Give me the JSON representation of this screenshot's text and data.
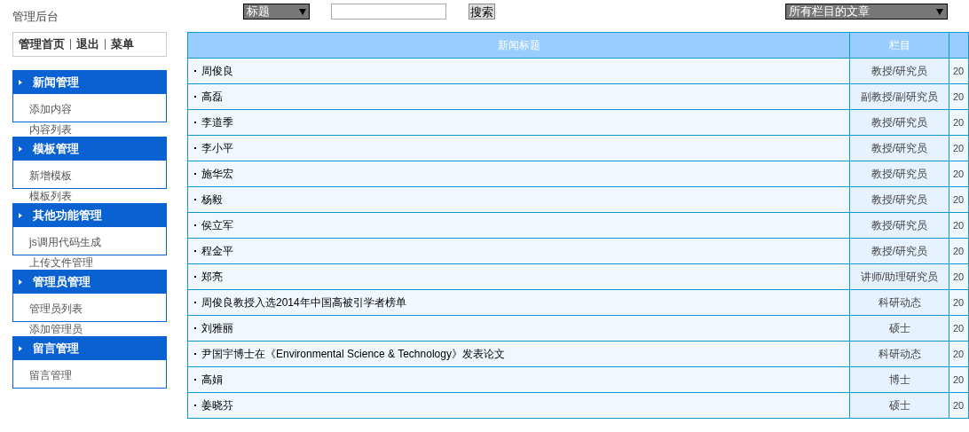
{
  "header": {
    "title": "管理后台",
    "search": {
      "field_select": "标题",
      "button": "搜索",
      "category_select": "所有栏目的文章"
    }
  },
  "top_nav": [
    "管理首页",
    "退出",
    "菜单"
  ],
  "sidebar": [
    {
      "title": "新闻管理",
      "items": [
        "添加内容",
        "内容列表"
      ]
    },
    {
      "title": "模板管理",
      "items": [
        "新增模板",
        "模板列表"
      ]
    },
    {
      "title": "其他功能管理",
      "items": [
        "js调用代码生成",
        "上传文件管理"
      ]
    },
    {
      "title": "管理员管理",
      "items": [
        "管理员列表",
        "添加管理员"
      ]
    },
    {
      "title": "留言管理",
      "items": [
        "留言管理"
      ]
    }
  ],
  "table": {
    "columns": [
      "新闻标题",
      "栏目"
    ],
    "rows": [
      {
        "title": "周俊良",
        "category": "教授/研究员",
        "column_3": "20"
      },
      {
        "title": "高磊",
        "category": "副教授/副研究员",
        "column_3": "20"
      },
      {
        "title": "李道季",
        "category": "教授/研究员",
        "column_3": "20"
      },
      {
        "title": "李小平",
        "category": "教授/研究员",
        "column_3": "20"
      },
      {
        "title": "施华宏",
        "category": "教授/研究员",
        "column_3": "20"
      },
      {
        "title": "杨毅",
        "category": "教授/研究员",
        "column_3": "20"
      },
      {
        "title": "侯立军",
        "category": "教授/研究员",
        "column_3": "20"
      },
      {
        "title": "程金平",
        "category": "教授/研究员",
        "column_3": "20"
      },
      {
        "title": "郑亮",
        "category": "讲师/助理研究员",
        "column_3": "20"
      },
      {
        "title": "周俊良教授入选2014年中国高被引学者榜单",
        "category": "科研动态",
        "column_3": "20"
      },
      {
        "title": "刘雅丽",
        "category": "硕士",
        "column_3": "20"
      },
      {
        "title": "尹国宇博士在《Environmental Science & Technology》发表论文",
        "category": "科研动态",
        "column_3": "20"
      },
      {
        "title": "高娟",
        "category": "博士",
        "column_3": "20"
      },
      {
        "title": "姜晓芬",
        "category": "硕士",
        "column_3": "20"
      }
    ]
  }
}
